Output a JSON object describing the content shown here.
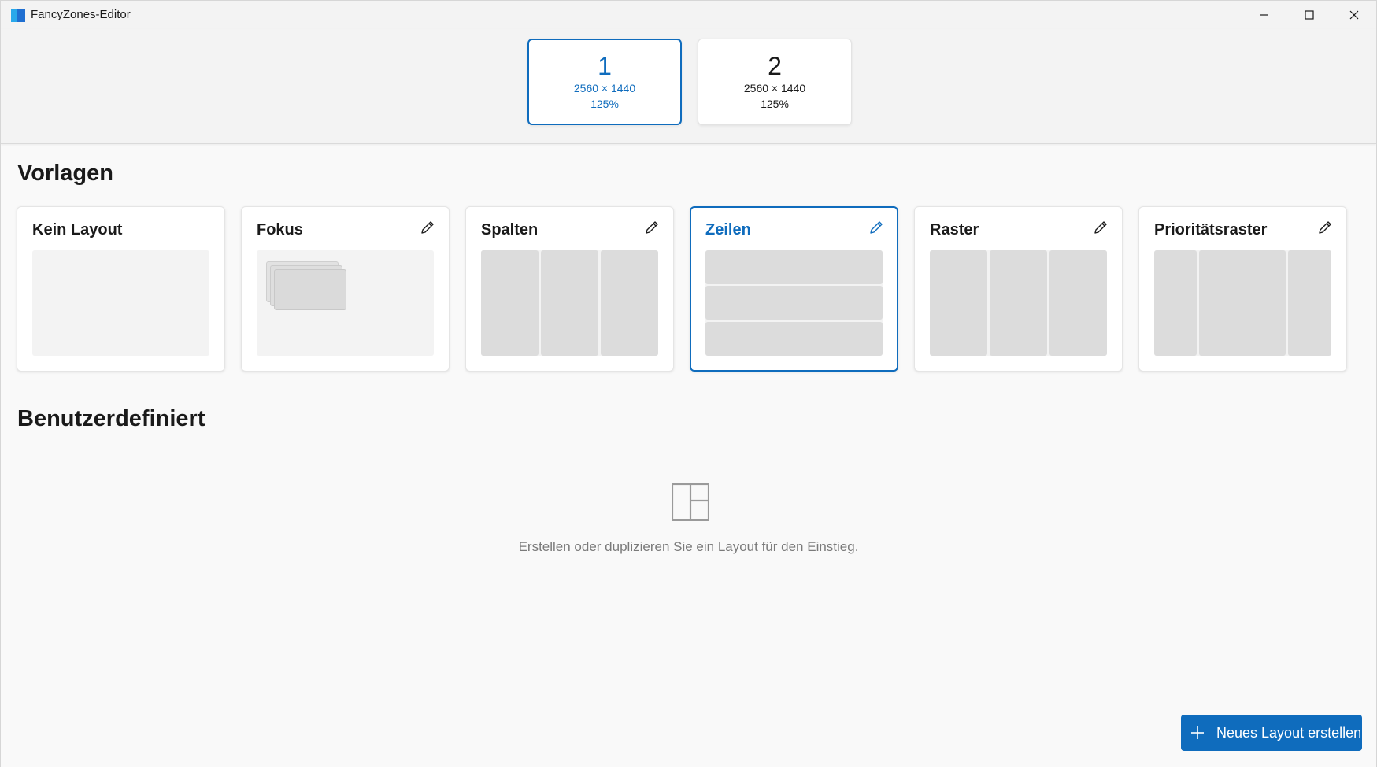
{
  "window": {
    "title": "FancyZones-Editor"
  },
  "monitors": [
    {
      "number": "1",
      "resolution": "2560 × 1440",
      "scale": "125%",
      "selected": true
    },
    {
      "number": "2",
      "resolution": "2560 × 1440",
      "scale": "125%",
      "selected": false
    }
  ],
  "templates": {
    "heading": "Vorlagen",
    "items": [
      {
        "label": "Kein Layout",
        "editable": false,
        "selected": false,
        "preview": "blank"
      },
      {
        "label": "Fokus",
        "editable": true,
        "selected": false,
        "preview": "focus"
      },
      {
        "label": "Spalten",
        "editable": true,
        "selected": false,
        "preview": "columns"
      },
      {
        "label": "Zeilen",
        "editable": true,
        "selected": true,
        "preview": "rows"
      },
      {
        "label": "Raster",
        "editable": true,
        "selected": false,
        "preview": "grid"
      },
      {
        "label": "Prioritätsraster",
        "editable": true,
        "selected": false,
        "preview": "priority-grid"
      }
    ]
  },
  "custom": {
    "heading": "Benutzerdefiniert",
    "empty_icon": "layout-icon",
    "empty_message": "Erstellen oder duplizieren Sie ein Layout für den Einstieg."
  },
  "actions": {
    "new_layout_label": "Neues Layout erstellen",
    "new_layout_icon": "plus-icon"
  },
  "colors": {
    "accent": "#0f6cbd",
    "zone": "#dcdcdc",
    "preview_bg": "#f3f3f3"
  }
}
